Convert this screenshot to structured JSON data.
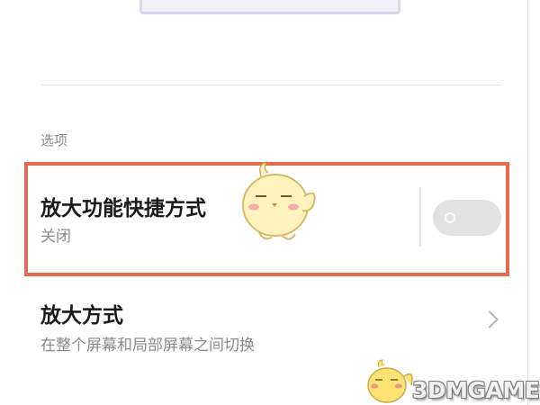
{
  "options": {
    "section_label": "选项",
    "items": [
      {
        "title": "放大功能快捷方式",
        "subtitle": "关闭",
        "control": "toggle",
        "toggle_on": false
      },
      {
        "title": "放大方式",
        "subtitle": "在整个屏幕和局部屏幕之间切换",
        "control": "chevron-right-icon"
      }
    ]
  },
  "watermark": {
    "text": "3DMGAME"
  },
  "colors": {
    "highlight": "#e8694a",
    "toggle_off": "#e2e2e2",
    "divider": "#e3e3e3"
  }
}
